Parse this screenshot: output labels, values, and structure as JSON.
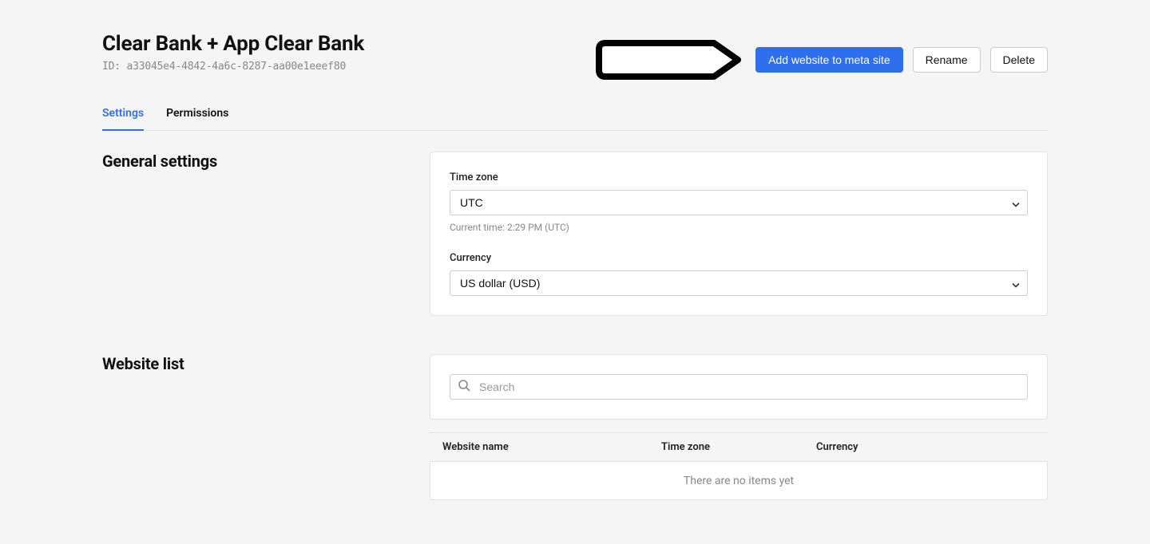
{
  "header": {
    "title": "Clear Bank + App Clear Bank",
    "id_label": "ID: a33045e4-4842-4a6c-8287-aa00e1eeef80"
  },
  "actions": {
    "add_website": "Add website to meta site",
    "rename": "Rename",
    "delete": "Delete"
  },
  "tabs": {
    "settings": "Settings",
    "permissions": "Permissions"
  },
  "general": {
    "heading": "General settings",
    "timezone_label": "Time zone",
    "timezone_value": "UTC",
    "current_time_helper": "Current time: 2:29 PM (UTC)",
    "currency_label": "Currency",
    "currency_value": "US dollar (USD)"
  },
  "website_list": {
    "heading": "Website list",
    "search_placeholder": "Search",
    "columns": {
      "name": "Website name",
      "timezone": "Time zone",
      "currency": "Currency"
    },
    "empty_text": "There are no items yet"
  }
}
